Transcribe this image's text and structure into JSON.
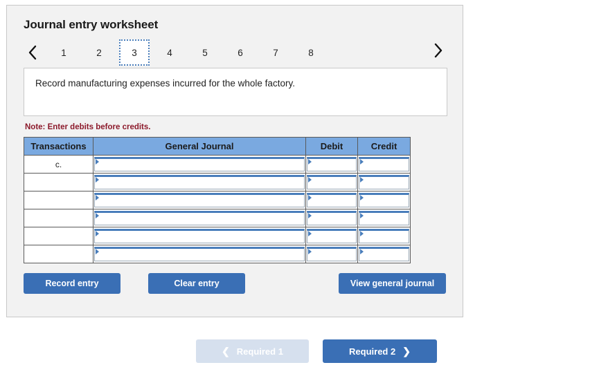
{
  "panel": {
    "title": "Journal entry worksheet",
    "nav": {
      "prev_icon": "chevron-left-icon",
      "next_icon": "chevron-right-icon",
      "tabs": [
        {
          "label": "1",
          "active": false
        },
        {
          "label": "2",
          "active": false
        },
        {
          "label": "3",
          "active": true
        },
        {
          "label": "4",
          "active": false
        },
        {
          "label": "5",
          "active": false
        },
        {
          "label": "6",
          "active": false
        },
        {
          "label": "7",
          "active": false
        },
        {
          "label": "8",
          "active": false
        }
      ]
    },
    "description": "Record manufacturing expenses incurred for the whole factory.",
    "note": "Note: Enter debits before credits.",
    "table": {
      "headers": [
        "Transactions",
        "General Journal",
        "Debit",
        "Credit"
      ],
      "rows": [
        {
          "transaction": "c.",
          "general_journal": "",
          "debit": "",
          "credit": ""
        },
        {
          "transaction": "",
          "general_journal": "",
          "debit": "",
          "credit": ""
        },
        {
          "transaction": "",
          "general_journal": "",
          "debit": "",
          "credit": ""
        },
        {
          "transaction": "",
          "general_journal": "",
          "debit": "",
          "credit": ""
        },
        {
          "transaction": "",
          "general_journal": "",
          "debit": "",
          "credit": ""
        },
        {
          "transaction": "",
          "general_journal": "",
          "debit": "",
          "credit": ""
        }
      ]
    },
    "buttons": {
      "record": "Record entry",
      "clear": "Clear entry",
      "view": "View general journal"
    }
  },
  "bottom_nav": {
    "prev_label": "Required 1",
    "prev_icon": "chevron-left-icon",
    "next_label": "Required 2",
    "next_icon": "chevron-right-icon"
  },
  "colors": {
    "accent_blue": "#3a6fb5",
    "header_blue": "#7aa9e0",
    "disabled_blue": "#d6e0ee",
    "note_red": "#8c1a2b",
    "panel_bg": "#f2f2f2"
  }
}
